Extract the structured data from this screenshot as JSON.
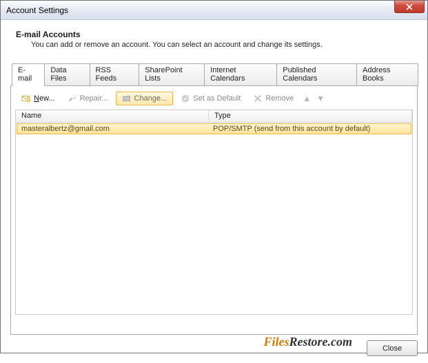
{
  "window": {
    "title": "Account Settings",
    "close_label": "Close"
  },
  "header": {
    "title": "E-mail Accounts",
    "subtitle": "You can add or remove an account. You can select an account and change its settings."
  },
  "tabs": [
    {
      "label": "E-mail",
      "active": true
    },
    {
      "label": "Data Files",
      "active": false
    },
    {
      "label": "RSS Feeds",
      "active": false
    },
    {
      "label": "SharePoint Lists",
      "active": false
    },
    {
      "label": "Internet Calendars",
      "active": false
    },
    {
      "label": "Published Calendars",
      "active": false
    },
    {
      "label": "Address Books",
      "active": false
    }
  ],
  "toolbar": {
    "new_label": "New...",
    "repair_label": "Repair...",
    "change_label": "Change...",
    "default_label": "Set as Default",
    "remove_label": "Remove"
  },
  "grid": {
    "columns": {
      "name": "Name",
      "type": "Type"
    },
    "rows": [
      {
        "name": "masteralbertz@gmail.com",
        "type": "POP/SMTP (send from this account by default)"
      }
    ]
  },
  "watermark": {
    "a": "Files",
    "b": "Restore.com"
  }
}
